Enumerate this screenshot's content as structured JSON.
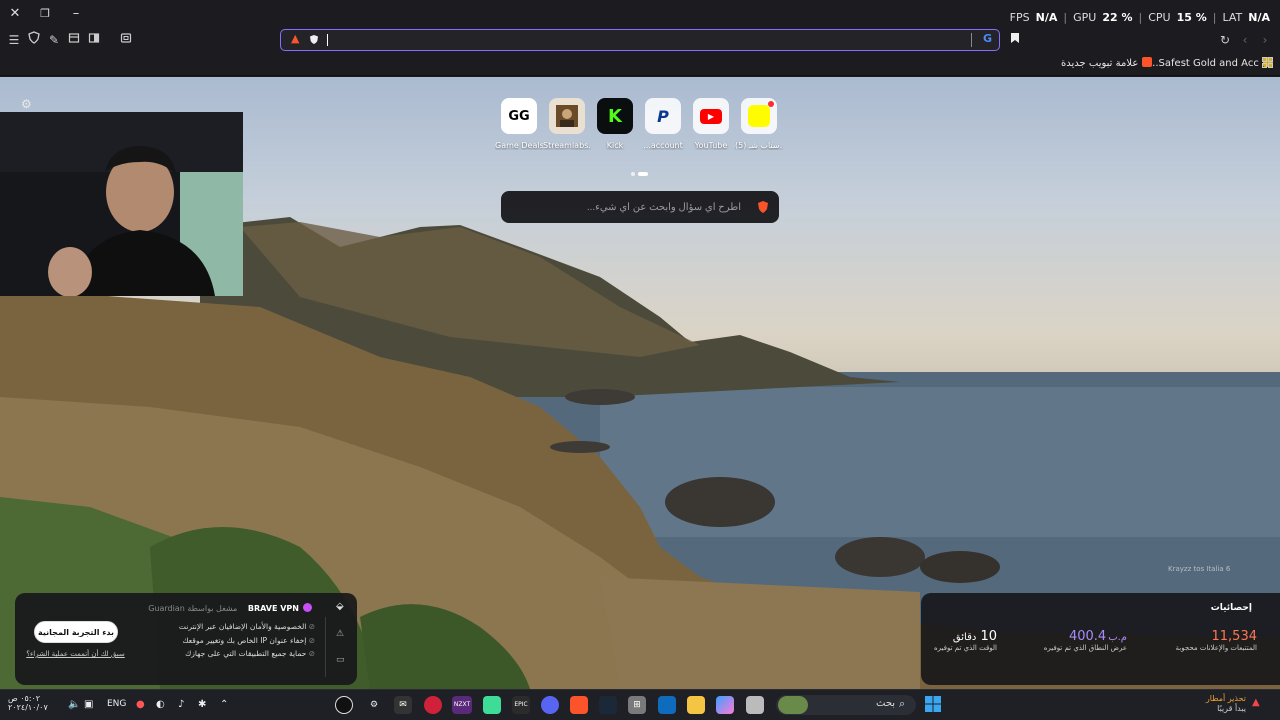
{
  "titlebar": {
    "overlay": {
      "fps_label": "FPS",
      "fps_value": "N/A",
      "gpu_label": "GPU",
      "gpu_value": "22 %",
      "cpu_label": "CPU",
      "cpu_value": "15 %",
      "lat_label": "LAT",
      "lat_value": "N/A"
    }
  },
  "toolbar": {
    "address_value": ""
  },
  "bookmarks": {
    "items": [
      {
        "label": "Safest Gold and Acc...",
        "color": "#d7b125"
      },
      {
        "label": "علامة تبويب جديدة",
        "color": "#fb542b"
      }
    ]
  },
  "top_sites": [
    {
      "label": "Game Deals",
      "glyph": "GG",
      "bg": "#ffffff",
      "fg": "#000000"
    },
    {
      "label": "Streamlabs...",
      "glyph": "",
      "bg": "#e9e0d1",
      "fg": "#5b3e20"
    },
    {
      "label": "Kick",
      "glyph": "K",
      "bg": "#ffffff",
      "fg": "#53fc18"
    },
    {
      "label": "...account",
      "glyph": "P",
      "bg": "#ffffff",
      "fg": "#0a3a8f"
    },
    {
      "label": "YouTube",
      "glyph": "▶",
      "bg": "#ffffff",
      "fg": "#ff0000"
    },
    {
      "label": "(5) سناب شـ...",
      "glyph": "",
      "bg": "#ffffff",
      "fg": "#fffc00"
    }
  ],
  "ntp_search": {
    "placeholder": "اطرح أي سؤال وابحث عن أي شيء..."
  },
  "vpn": {
    "title": "BRAVE VPN",
    "powered": "مشغل بواسطة Guardian",
    "features": [
      "الخصوصية والأمان الإضافيان عبر الإنترنت",
      "إخفاء عنوان IP الخاص بك وتغيير موقعك",
      "حماية جميع التطبيقات التي على جهازك"
    ],
    "cta": "بدء التجربة المجانية",
    "already": "سبق لك أن أتممت عملية الشراء؟"
  },
  "stats": {
    "title": "إحصائيات",
    "items": [
      {
        "value": "11,534",
        "unit": "",
        "label": "المتتبعات والإعلانات محجوبة",
        "color": "#ff7654"
      },
      {
        "value": "400.4",
        "unit": "م.ب",
        "label": "عرض النطاق الذي تم توفيره",
        "color": "#a78bfa"
      },
      {
        "value": "10",
        "unit": "دقائق",
        "label": "الوقت الذي تم توفيره",
        "color": "#ffffff"
      }
    ]
  },
  "watermark": "Krayzz tos Italia 6",
  "taskbar": {
    "search_placeholder": "بحث",
    "weather_title": "تحذير أمطار",
    "weather_sub": "يبدأ قريبًا",
    "time": "٠٥:٠٢ ص",
    "date": "٢٠٢٤/١٠/٠٧",
    "lang": "ENG"
  }
}
